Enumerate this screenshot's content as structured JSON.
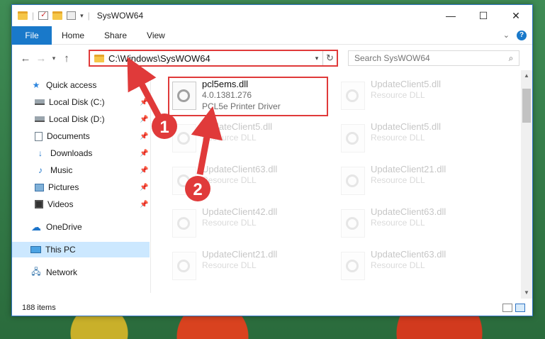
{
  "window": {
    "title": "SysWOW64",
    "controls": {
      "minimize": "—",
      "maximize": "☐",
      "close": "✕"
    }
  },
  "ribbon": {
    "file_tab": "File",
    "tabs": [
      "Home",
      "Share",
      "View"
    ],
    "help": "?"
  },
  "address": {
    "path": "C:\\Windows\\SysWOW64",
    "search_placeholder": "Search SysWOW64"
  },
  "sidebar": {
    "quick_access": "Quick access",
    "items": [
      {
        "label": "Local Disk (C:)",
        "icon": "drive-icon",
        "pinned": true
      },
      {
        "label": "Local Disk (D:)",
        "icon": "drive-icon",
        "pinned": true
      },
      {
        "label": "Documents",
        "icon": "documents-icon",
        "pinned": true
      },
      {
        "label": "Downloads",
        "icon": "downloads-icon",
        "pinned": true
      },
      {
        "label": "Music",
        "icon": "music-icon",
        "pinned": true
      },
      {
        "label": "Pictures",
        "icon": "pictures-icon",
        "pinned": true
      },
      {
        "label": "Videos",
        "icon": "videos-icon",
        "pinned": true
      }
    ],
    "onedrive": "OneDrive",
    "this_pc": "This PC",
    "network": "Network"
  },
  "files": [
    {
      "name": "pcl5ems.dll",
      "line2": "4.0.1381.276",
      "line3": "PCL5e Printer Driver",
      "highlighted": true
    },
    {
      "name": "UpdateClient5.dll",
      "line2": "Resource DLL",
      "line3": ""
    },
    {
      "name": "UpdateClient5.dll",
      "line2": "Resource DLL",
      "line3": ""
    },
    {
      "name": "UpdateClient5.dll",
      "line2": "Resource DLL",
      "line3": ""
    },
    {
      "name": "UpdateClient63.dll",
      "line2": "Resource DLL",
      "line3": ""
    },
    {
      "name": "UpdateClient21.dll",
      "line2": "Resource DLL",
      "line3": ""
    },
    {
      "name": "UpdateClient42.dll",
      "line2": "Resource DLL",
      "line3": ""
    },
    {
      "name": "UpdateClient63.dll",
      "line2": "Resource DLL",
      "line3": ""
    },
    {
      "name": "UpdateClient21.dll",
      "line2": "Resource DLL",
      "line3": ""
    },
    {
      "name": "UpdateClient63.dll",
      "line2": "Resource DLL",
      "line3": ""
    }
  ],
  "status": {
    "item_count": "188 items"
  },
  "annotations": {
    "step1": "1",
    "step2": "2",
    "color": "#e03a3a"
  }
}
